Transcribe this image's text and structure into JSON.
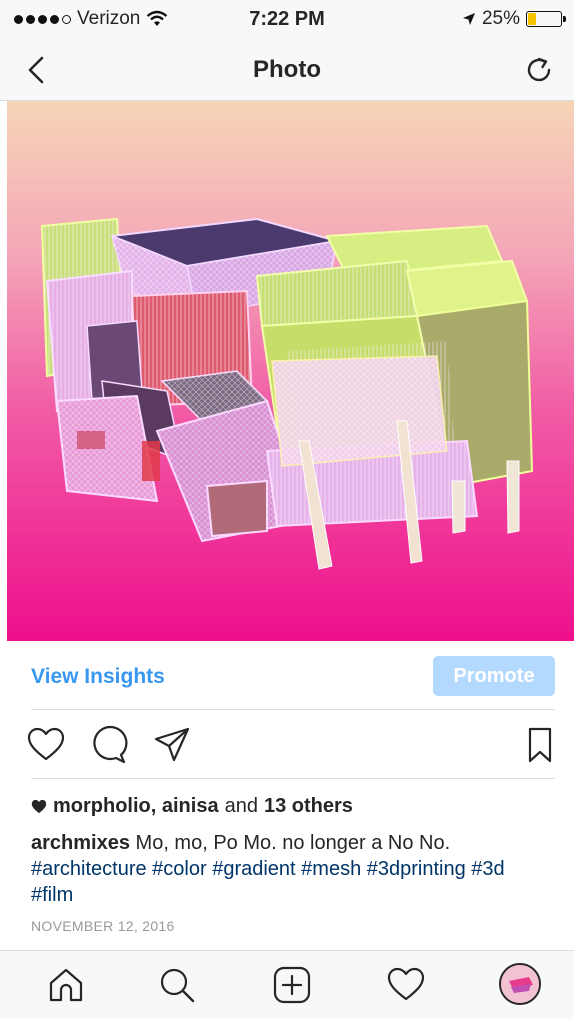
{
  "status_bar": {
    "carrier": "Verizon",
    "time": "7:22 PM",
    "battery": "25%",
    "battery_level": 0.25
  },
  "header": {
    "title": "Photo",
    "back_icon": "chevron-left-icon",
    "refresh_icon": "refresh-icon"
  },
  "post": {
    "view_insights": "View Insights",
    "promote": "Promote",
    "likes": {
      "names": "morpholio, ainisa",
      "and": "and",
      "others": "13 others"
    },
    "caption": {
      "username": "archmixes",
      "text": "Mo, mo, Po Mo. no longer a No No.",
      "hashtags": "#architecture #color #gradient #mesh #3dprinting #3d #film"
    },
    "date": "NOVEMBER 12, 2016"
  },
  "colors": {
    "link": "#3897f0",
    "promote_bg": "#b3dafe",
    "hashtag": "#003569",
    "battery_fill": "#f5c400"
  }
}
